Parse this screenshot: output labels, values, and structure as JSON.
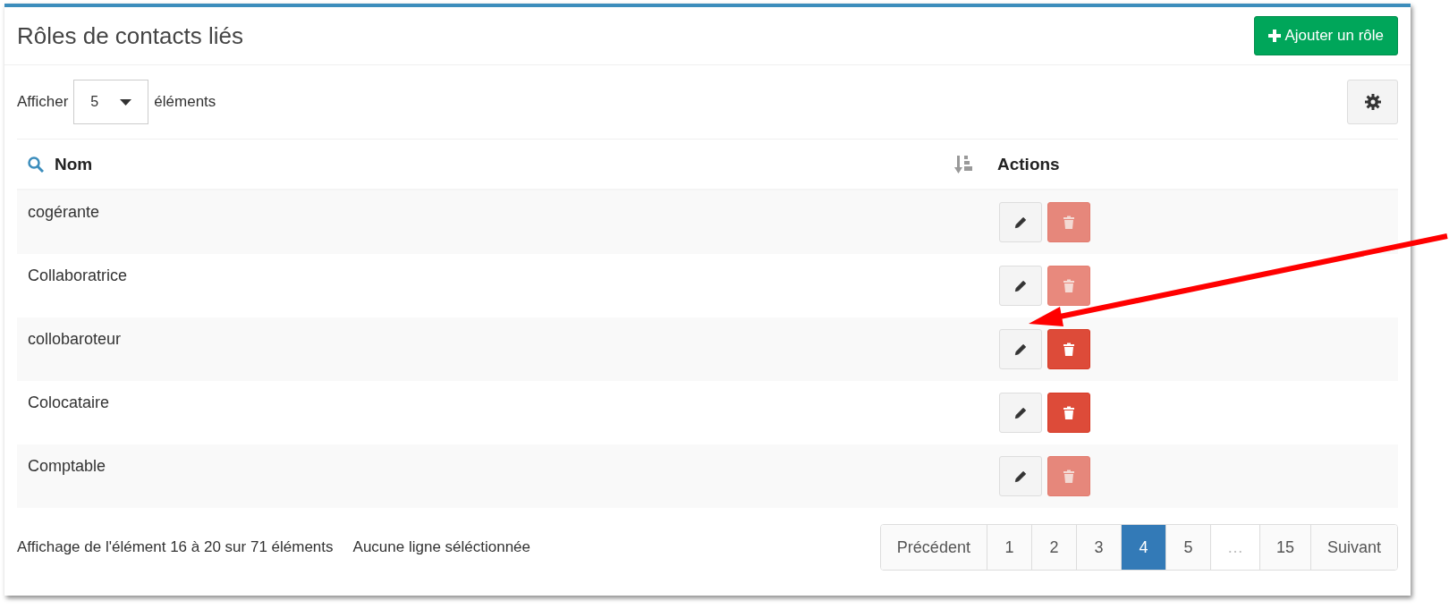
{
  "panel": {
    "title": "Rôles de contacts liés",
    "add_button": "Ajouter un rôle"
  },
  "toolbar": {
    "show_label": "Afficher",
    "page_size": "5",
    "items_label": "éléments"
  },
  "table": {
    "columns": [
      {
        "label": "Nom",
        "kind": "search"
      },
      {
        "label": "Actions",
        "kind": "plain"
      }
    ],
    "rows": [
      {
        "name": "cogérante",
        "delete_disabled": true
      },
      {
        "name": "Collaboratrice",
        "delete_disabled": true
      },
      {
        "name": "collobaroteur",
        "delete_disabled": false
      },
      {
        "name": "Colocataire",
        "delete_disabled": false
      },
      {
        "name": "Comptable",
        "delete_disabled": true
      }
    ]
  },
  "footer": {
    "info": "Affichage de l'élément 16 à 20 sur 71 éléments",
    "selection": "Aucune ligne séléctionnée"
  },
  "pagination": [
    {
      "label": "Précédent",
      "selected": false,
      "disabled": false
    },
    {
      "label": "1",
      "selected": false,
      "disabled": false
    },
    {
      "label": "2",
      "selected": false,
      "disabled": false
    },
    {
      "label": "3",
      "selected": false,
      "disabled": false
    },
    {
      "label": "4",
      "selected": true,
      "disabled": false
    },
    {
      "label": "5",
      "selected": false,
      "disabled": false
    },
    {
      "label": "…",
      "selected": false,
      "disabled": true
    },
    {
      "label": "15",
      "selected": false,
      "disabled": false
    },
    {
      "label": "Suivant",
      "selected": false,
      "disabled": false
    }
  ]
}
